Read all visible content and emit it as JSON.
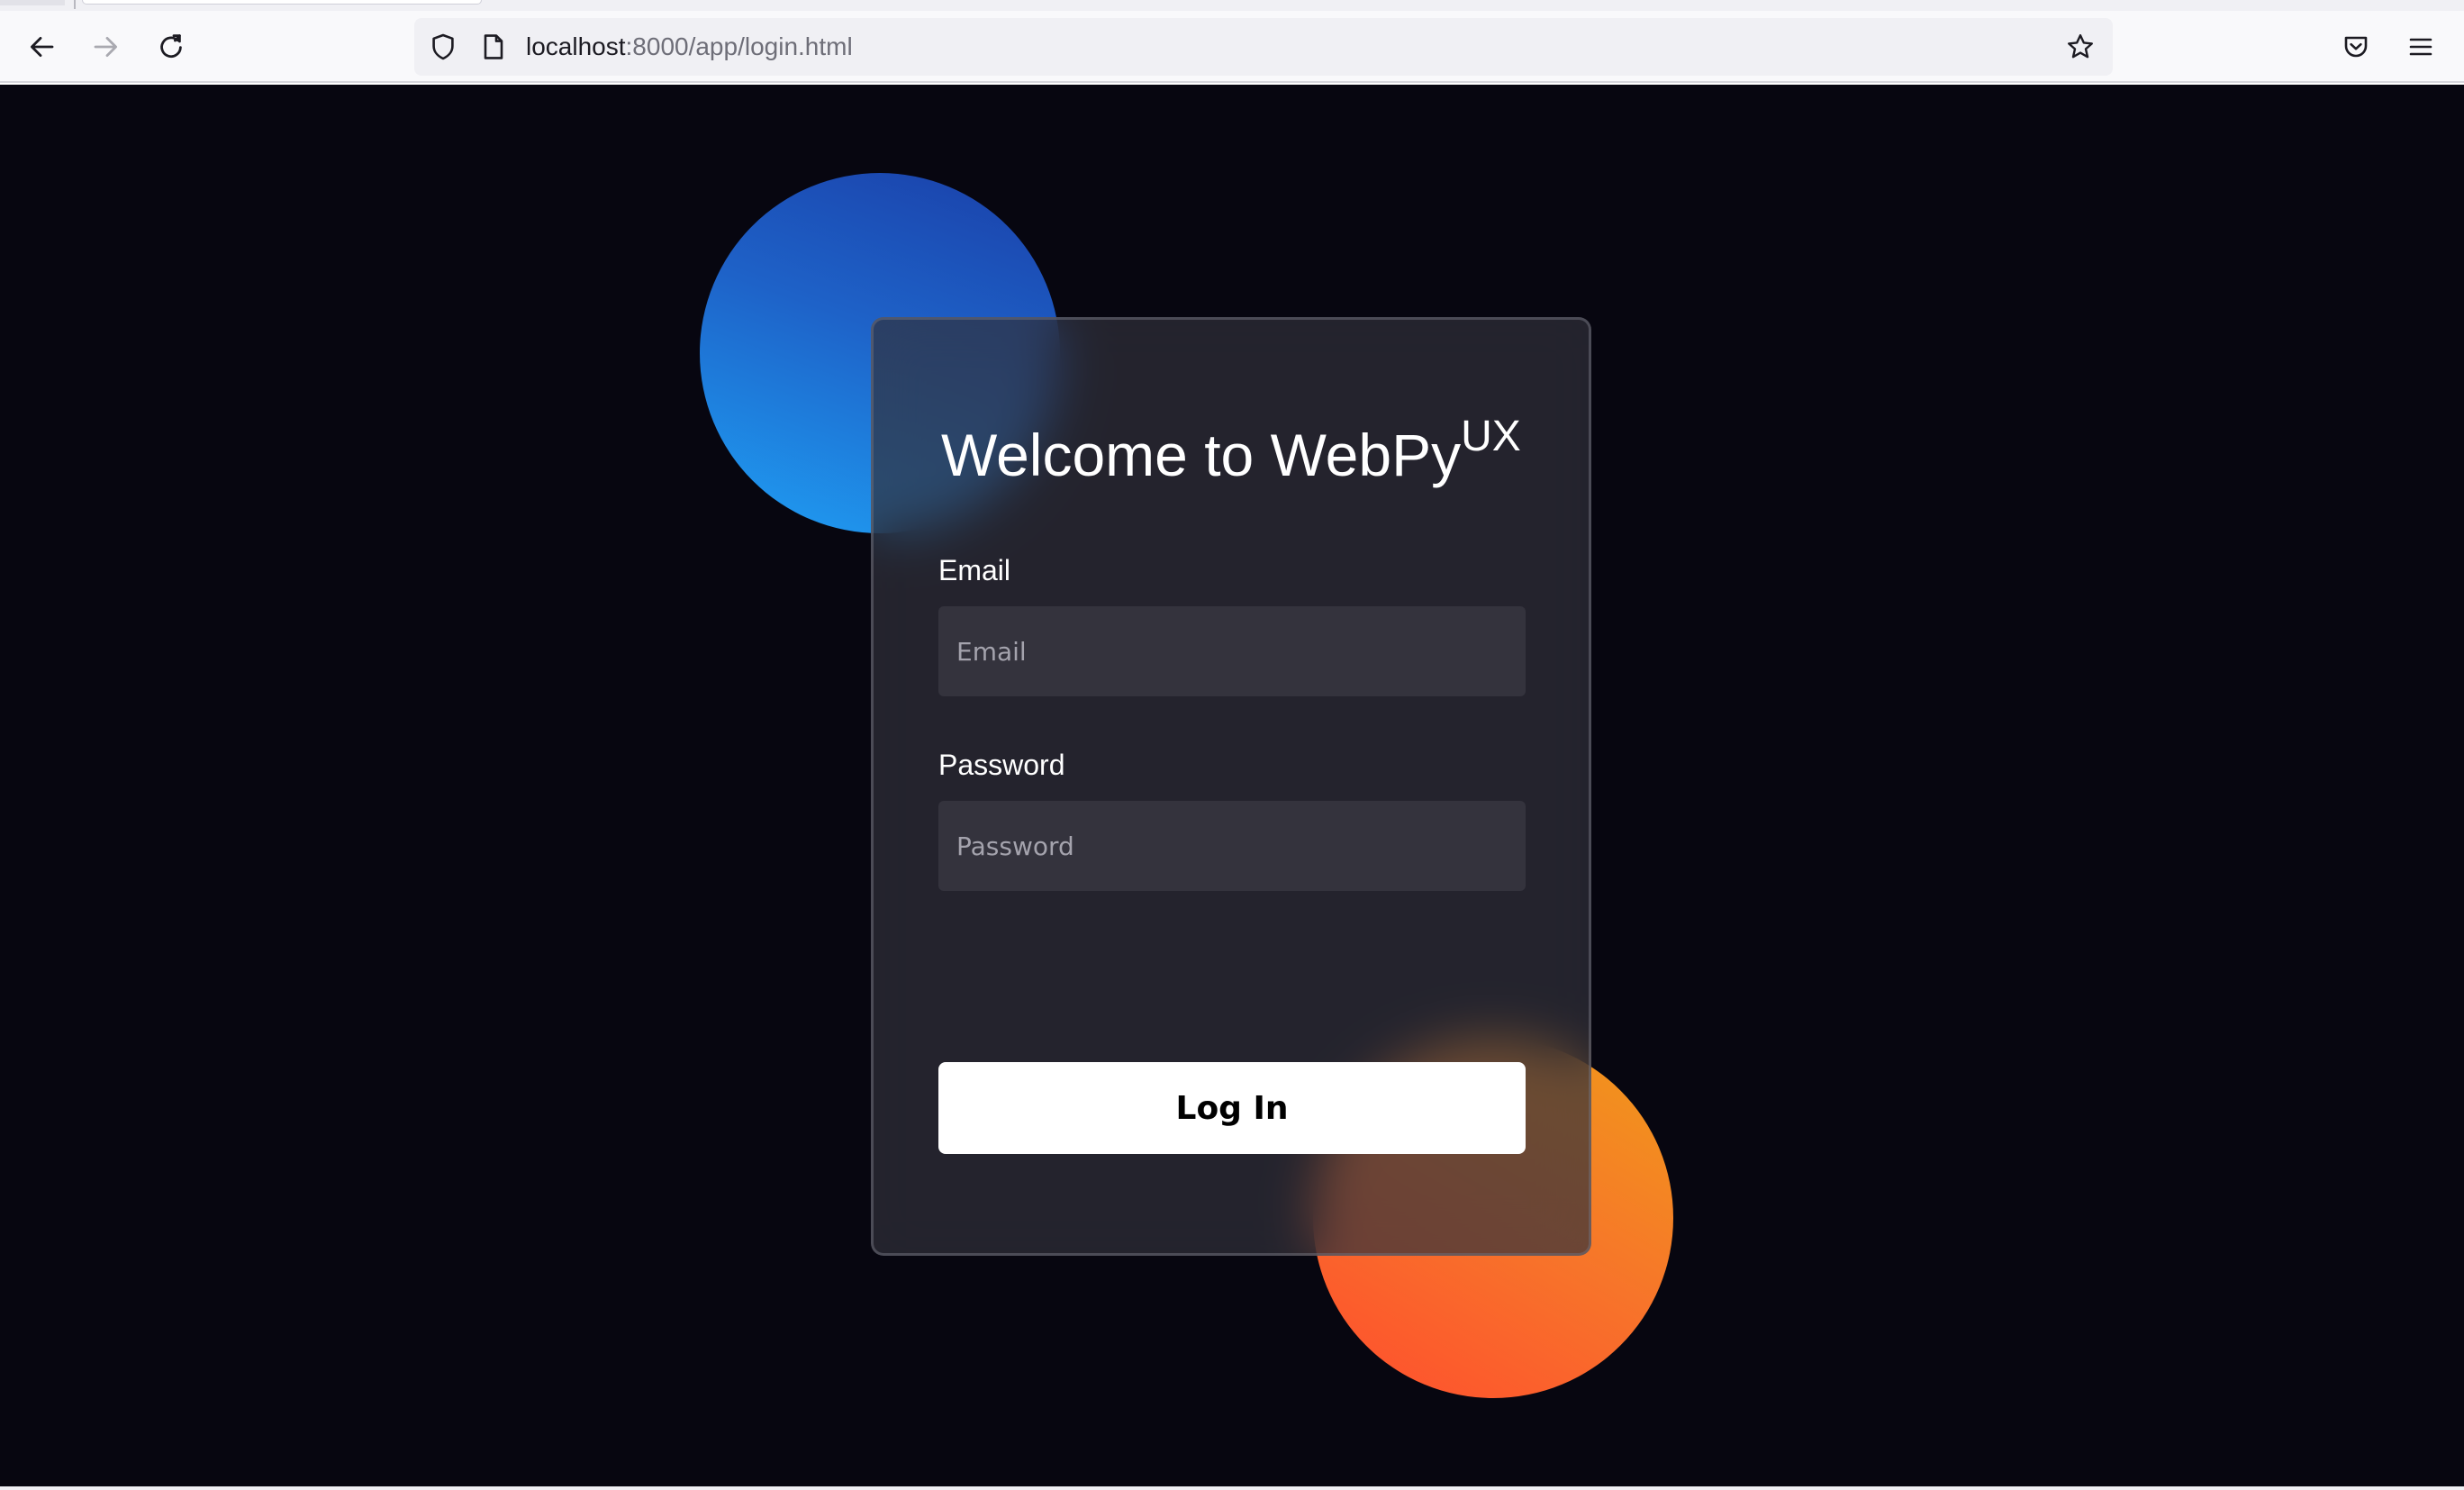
{
  "browser": {
    "url_host": "localhost",
    "url_rest": ":8000/app/login.html",
    "icons": {
      "back": "back-arrow-icon",
      "forward": "forward-arrow-icon",
      "reload": "reload-icon",
      "tracking_protection": "shield-icon",
      "page_info": "page-icon",
      "bookmark": "star-icon",
      "pocket": "pocket-icon",
      "menu": "hamburger-menu-icon"
    }
  },
  "login": {
    "title": "Welcome to WebPy",
    "title_sup": "UX",
    "email_label": "Email",
    "email_placeholder": "Email",
    "email_value": "",
    "password_label": "Password",
    "password_placeholder": "Password",
    "password_value": "",
    "submit_label": "Log In"
  },
  "colors": {
    "page_background": "#070610",
    "card_background": "#2b2a33",
    "input_background": "#34333d",
    "button_background": "#ffffff",
    "blob_blue": "#1e62c8",
    "blob_orange": "#f7742a"
  }
}
